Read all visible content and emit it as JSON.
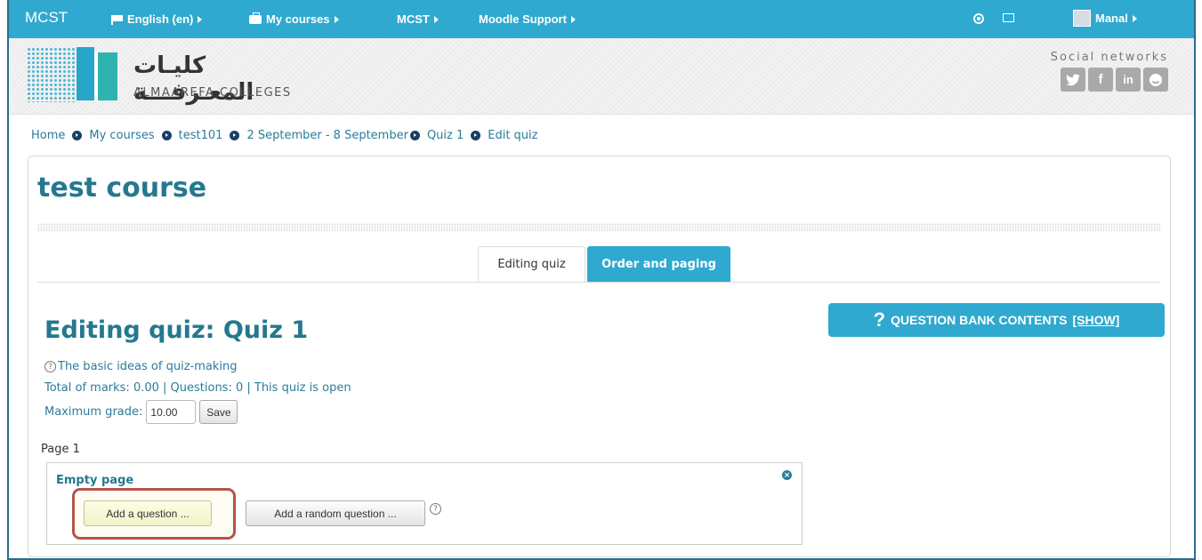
{
  "topnav": {
    "brand": "MCST",
    "language": "English (en)",
    "my_courses": "My courses",
    "mcst": "MCST",
    "support": "Moodle Support",
    "user": "Manal"
  },
  "header": {
    "logo_ar": "كليـات المعـرفـــة",
    "logo_en": "ALMAAREFA COLLEGES",
    "social_label": "Social networks",
    "social_icons": [
      "twitter-icon",
      "facebook-icon",
      "linkedin-icon",
      "smile-icon"
    ]
  },
  "breadcrumb": [
    "Home",
    "My courses",
    "test101",
    "2 September - 8 September",
    "Quiz 1",
    "Edit quiz"
  ],
  "course": {
    "title": "test course"
  },
  "tabs": [
    {
      "label": "Editing quiz",
      "active": true
    },
    {
      "label": "Order and paging",
      "active": false
    }
  ],
  "quiz": {
    "heading": "Editing quiz: Quiz 1",
    "help_link": "The basic ideas of quiz-making",
    "summary": "Total of marks: 0.00 | Questions: 0 | This quiz is open",
    "max_grade_label": "Maximum grade:",
    "max_grade_value": "10.00",
    "save_label": "Save",
    "qbank_label": "QUESTION BANK CONTENTS",
    "qbank_toggle": "[SHOW]",
    "page_label": "Page 1",
    "empty_page": "Empty page",
    "add_question": "Add a question ...",
    "add_random": "Add a random question ..."
  },
  "colors": {
    "accent": "#2fa9cf",
    "heading": "#24788f",
    "link": "#2a7c9b",
    "highlight": "#b4534e"
  }
}
